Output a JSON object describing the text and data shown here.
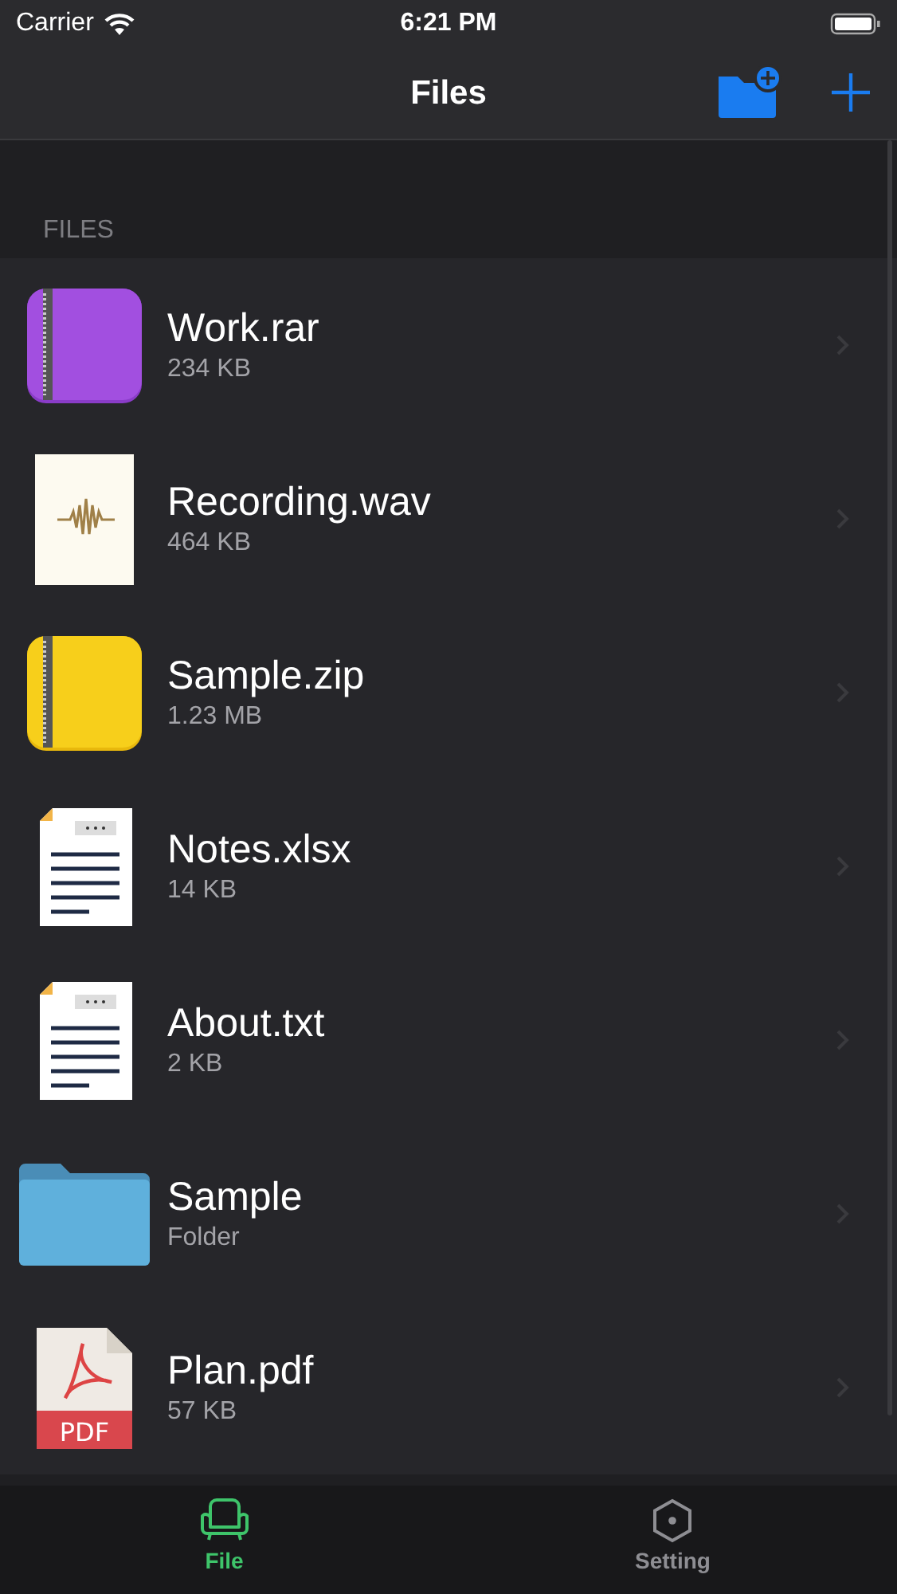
{
  "status_bar": {
    "carrier": "Carrier",
    "time": "6:21 PM"
  },
  "nav": {
    "title": "Files"
  },
  "section": {
    "header": "FILES"
  },
  "files": [
    {
      "kind": "rar",
      "name": "Work.rar",
      "detail": "234 KB"
    },
    {
      "kind": "wav",
      "name": "Recording.wav",
      "detail": "464 KB"
    },
    {
      "kind": "zip",
      "name": "Sample.zip",
      "detail": "1.23 MB"
    },
    {
      "kind": "doc",
      "name": "Notes.xlsx",
      "detail": "14 KB"
    },
    {
      "kind": "doc",
      "name": "About.txt",
      "detail": "2 KB"
    },
    {
      "kind": "folder",
      "name": "Sample",
      "detail": "Folder"
    },
    {
      "kind": "pdf",
      "name": "Plan.pdf",
      "detail": "57 KB",
      "icon_label": "PDF"
    }
  ],
  "tabs": [
    {
      "kind": "file",
      "label": "File",
      "selected": true
    },
    {
      "kind": "setting",
      "label": "Setting",
      "selected": false
    }
  ]
}
